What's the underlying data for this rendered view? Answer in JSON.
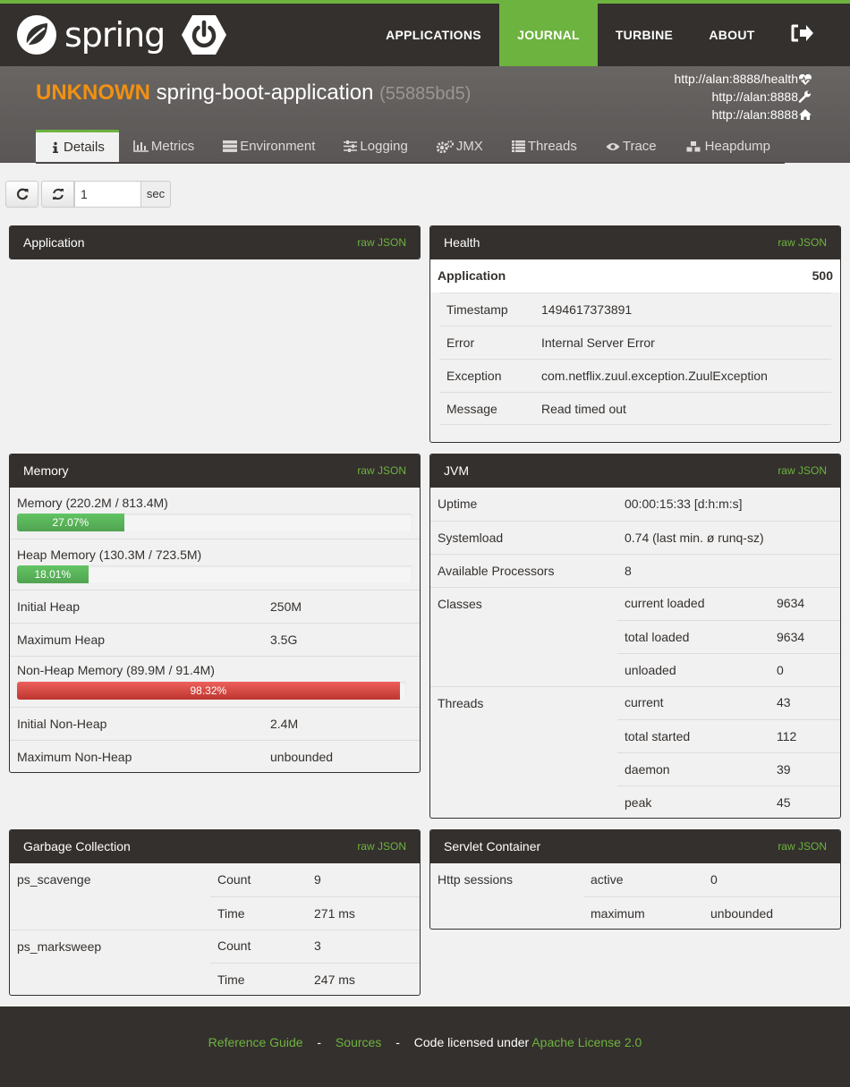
{
  "nav": {
    "logo_text": "spring",
    "items": [
      "APPLICATIONS",
      "JOURNAL",
      "TURBINE",
      "ABOUT"
    ],
    "active": "JOURNAL"
  },
  "header": {
    "status": "UNKNOWN",
    "name": "spring-boot-application",
    "id": "(55885bd5)",
    "health_url": "http://alan:8888/health",
    "management_url": "http://alan:8888",
    "service_url": "http://alan:8888"
  },
  "tabs": [
    "Details",
    "Metrics",
    "Environment",
    "Logging",
    "JMX",
    "Threads",
    "Trace",
    "Heapdump"
  ],
  "refresh": {
    "interval": "1",
    "unit": "sec"
  },
  "raw_json_label": "raw JSON",
  "application": {
    "title": "Application"
  },
  "health": {
    "title": "Health",
    "summary_label": "Application",
    "summary_value": "500",
    "rows": [
      {
        "k": "Timestamp",
        "v": "1494617373891"
      },
      {
        "k": "Error",
        "v": "Internal Server Error"
      },
      {
        "k": "Exception",
        "v": "com.netflix.zuul.exception.ZuulException"
      },
      {
        "k": "Message",
        "v": "Read timed out"
      }
    ]
  },
  "memory": {
    "title": "Memory",
    "mem_label": "Memory (220.2M / 813.4M)",
    "mem_pct": "27.07%",
    "mem_fraction": 0.2707,
    "heap_label": "Heap Memory (130.3M / 723.5M)",
    "heap_pct": "18.01%",
    "heap_fraction": 0.1801,
    "init_heap_label": "Initial Heap",
    "init_heap": "250M",
    "max_heap_label": "Maximum Heap",
    "max_heap": "3.5G",
    "nonheap_label": "Non-Heap Memory (89.9M / 91.4M)",
    "nonheap_pct": "98.32%",
    "nonheap_fraction": 0.9832,
    "init_nonheap_label": "Initial Non-Heap",
    "init_nonheap": "2.4M",
    "max_nonheap_label": "Maximum Non-Heap",
    "max_nonheap": "unbounded"
  },
  "jvm": {
    "title": "JVM",
    "uptime_label": "Uptime",
    "uptime": "00:00:15:33 [d:h:m:s]",
    "sysload_label": "Systemload",
    "sysload": "0.74 (last min. ø runq-sz)",
    "procs_label": "Available Processors",
    "procs": "8",
    "classes_label": "Classes",
    "classes": [
      {
        "k": "current loaded",
        "v": "9634"
      },
      {
        "k": "total loaded",
        "v": "9634"
      },
      {
        "k": "unloaded",
        "v": "0"
      }
    ],
    "threads_label": "Threads",
    "threads": [
      {
        "k": "current",
        "v": "43"
      },
      {
        "k": "total started",
        "v": "112"
      },
      {
        "k": "daemon",
        "v": "39"
      },
      {
        "k": "peak",
        "v": "45"
      }
    ]
  },
  "gc": {
    "title": "Garbage Collection",
    "collectors": [
      {
        "name": "ps_scavenge",
        "count_label": "Count",
        "count": "9",
        "time_label": "Time",
        "time": "271 ms"
      },
      {
        "name": "ps_marksweep",
        "count_label": "Count",
        "count": "3",
        "time_label": "Time",
        "time": "247 ms"
      }
    ]
  },
  "servlet": {
    "title": "Servlet Container",
    "label": "Http sessions",
    "active_label": "active",
    "active": "0",
    "max_label": "maximum",
    "max": "unbounded"
  },
  "footer": {
    "ref": "Reference Guide",
    "dash1": "-",
    "sources": "Sources",
    "dash2": "-",
    "license_text": "Code licensed under",
    "license_link": "Apache License 2.0"
  }
}
